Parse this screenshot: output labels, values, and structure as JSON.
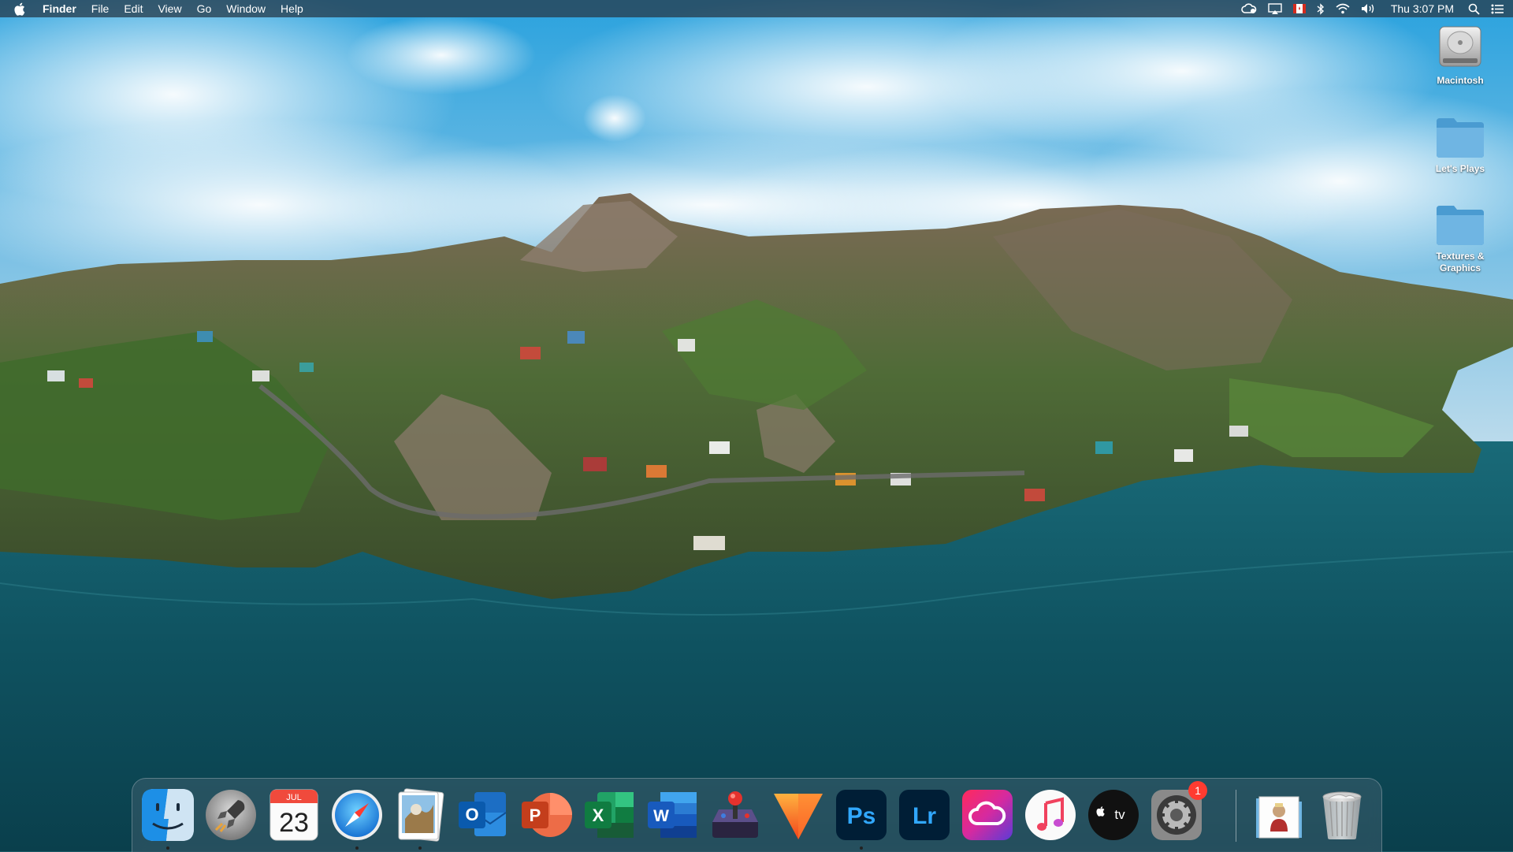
{
  "menubar": {
    "app_name": "Finder",
    "menus": [
      "File",
      "Edit",
      "View",
      "Go",
      "Window",
      "Help"
    ],
    "clock": "Thu 3:07 PM"
  },
  "desktop": {
    "items": [
      {
        "label": "Macintosh",
        "icon": "hard-drive-icon"
      },
      {
        "label": "Let's Plays",
        "icon": "folder-icon"
      },
      {
        "label": "Textures & Graphics",
        "icon": "folder-icon"
      }
    ]
  },
  "dock": {
    "calendar": {
      "month": "JUL",
      "day": "23"
    },
    "apps": [
      {
        "name": "Finder",
        "icon": "finder-icon",
        "running": true
      },
      {
        "name": "Launchpad",
        "icon": "launchpad-icon",
        "running": false
      },
      {
        "name": "Calendar",
        "icon": "calendar-icon",
        "running": false
      },
      {
        "name": "Safari",
        "icon": "safari-icon",
        "running": true
      },
      {
        "name": "Preview",
        "icon": "preview-icon",
        "running": true
      },
      {
        "name": "Outlook",
        "icon": "outlook-icon",
        "running": false
      },
      {
        "name": "PowerPoint",
        "icon": "powerpoint-icon",
        "running": false
      },
      {
        "name": "Excel",
        "icon": "excel-icon",
        "running": false
      },
      {
        "name": "Word",
        "icon": "word-icon",
        "running": false
      },
      {
        "name": "Arcade",
        "icon": "arcade-joystick-icon",
        "running": false
      },
      {
        "name": "Vectorize",
        "icon": "vector-triangle-icon",
        "running": false
      },
      {
        "name": "Photoshop",
        "icon": "photoshop-icon",
        "running": true
      },
      {
        "name": "Lightroom",
        "icon": "lightroom-icon",
        "running": false
      },
      {
        "name": "Creative Cloud",
        "icon": "creative-cloud-icon",
        "running": false
      },
      {
        "name": "Music",
        "icon": "music-icon",
        "running": false
      },
      {
        "name": "TV",
        "icon": "apple-tv-icon",
        "running": false
      },
      {
        "name": "System Preferences",
        "icon": "system-preferences-icon",
        "running": false,
        "badge": "1"
      }
    ],
    "labels": {
      "ps": "Ps",
      "lr": "Lr",
      "tv": "tv",
      "outlook": "O",
      "powerpoint": "P",
      "excel": "X",
      "word": "W"
    },
    "documents": {
      "icon": "documents-stack-icon"
    },
    "trash": {
      "icon": "trash-icon"
    }
  },
  "colors": {
    "sky": "#2f9fd8",
    "water": "#10505e",
    "dock_badge": "#ff3b30"
  }
}
